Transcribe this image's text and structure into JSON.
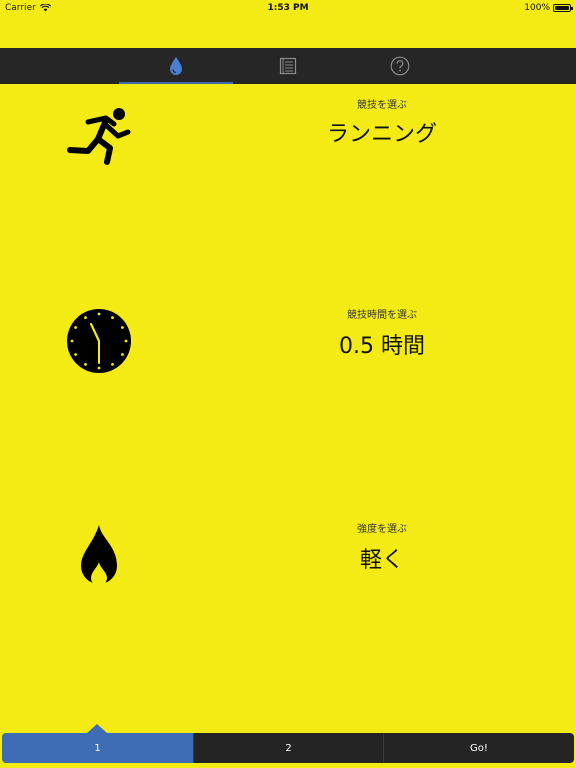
{
  "status_bar": {
    "carrier": "Carrier",
    "time": "1:53 PM",
    "battery": "100%"
  },
  "top_tabs": [
    {
      "icon": "water-drop-icon",
      "active": true
    },
    {
      "icon": "notes-icon",
      "active": false
    },
    {
      "icon": "help-icon",
      "active": false
    }
  ],
  "sport": {
    "caption": "競技を選ぶ",
    "value": "ランニング",
    "icon": "running-person-icon"
  },
  "duration": {
    "caption": "競技時間を選ぶ",
    "value": "0.5 時間",
    "icon": "clock-icon"
  },
  "intensity": {
    "caption": "強度を選ぶ",
    "value": "軽く",
    "icon": "flame-icon"
  },
  "bottom_tabs": [
    {
      "label": "1",
      "active": true
    },
    {
      "label": "2",
      "active": false
    },
    {
      "label": "Go!",
      "active": false
    }
  ],
  "colors": {
    "background": "#f5eb14",
    "accent": "#3f6db5",
    "bar": "#262626"
  }
}
